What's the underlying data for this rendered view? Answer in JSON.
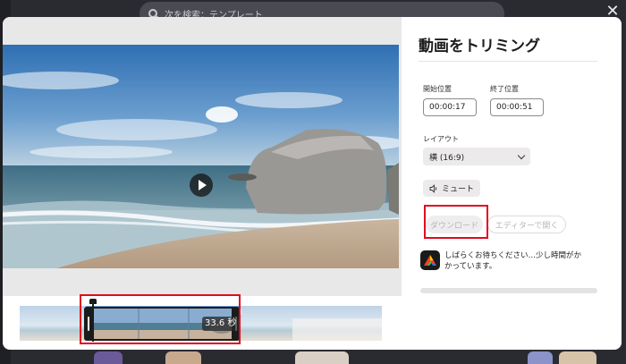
{
  "background": {
    "search_placeholder": "次を検索：テンプレート"
  },
  "dialog": {
    "title": "動画をトリミング",
    "start_label": "開始位置",
    "start_value": "00:00:17",
    "end_label": "終了位置",
    "end_value": "00:00:51",
    "layout_label": "レイアウト",
    "layout_value": "横 (16:9)",
    "mute_label": "ミュート",
    "download_label": "ダウンロード",
    "open_editor_label": "エディターで開く",
    "wait_message": "しばらくお待ちください…少し時間がかかっています。",
    "progress": 0
  },
  "timeline": {
    "selection_duration": "33.6 秒"
  },
  "icons": {
    "close": "close-icon",
    "play": "play-icon",
    "speaker": "speaker-icon",
    "chevron": "chevron-down-icon",
    "app_logo": "adobe-express-logo"
  },
  "colors": {
    "highlight_box": "#e10b1e",
    "trim_border": "#1b1b1b"
  }
}
